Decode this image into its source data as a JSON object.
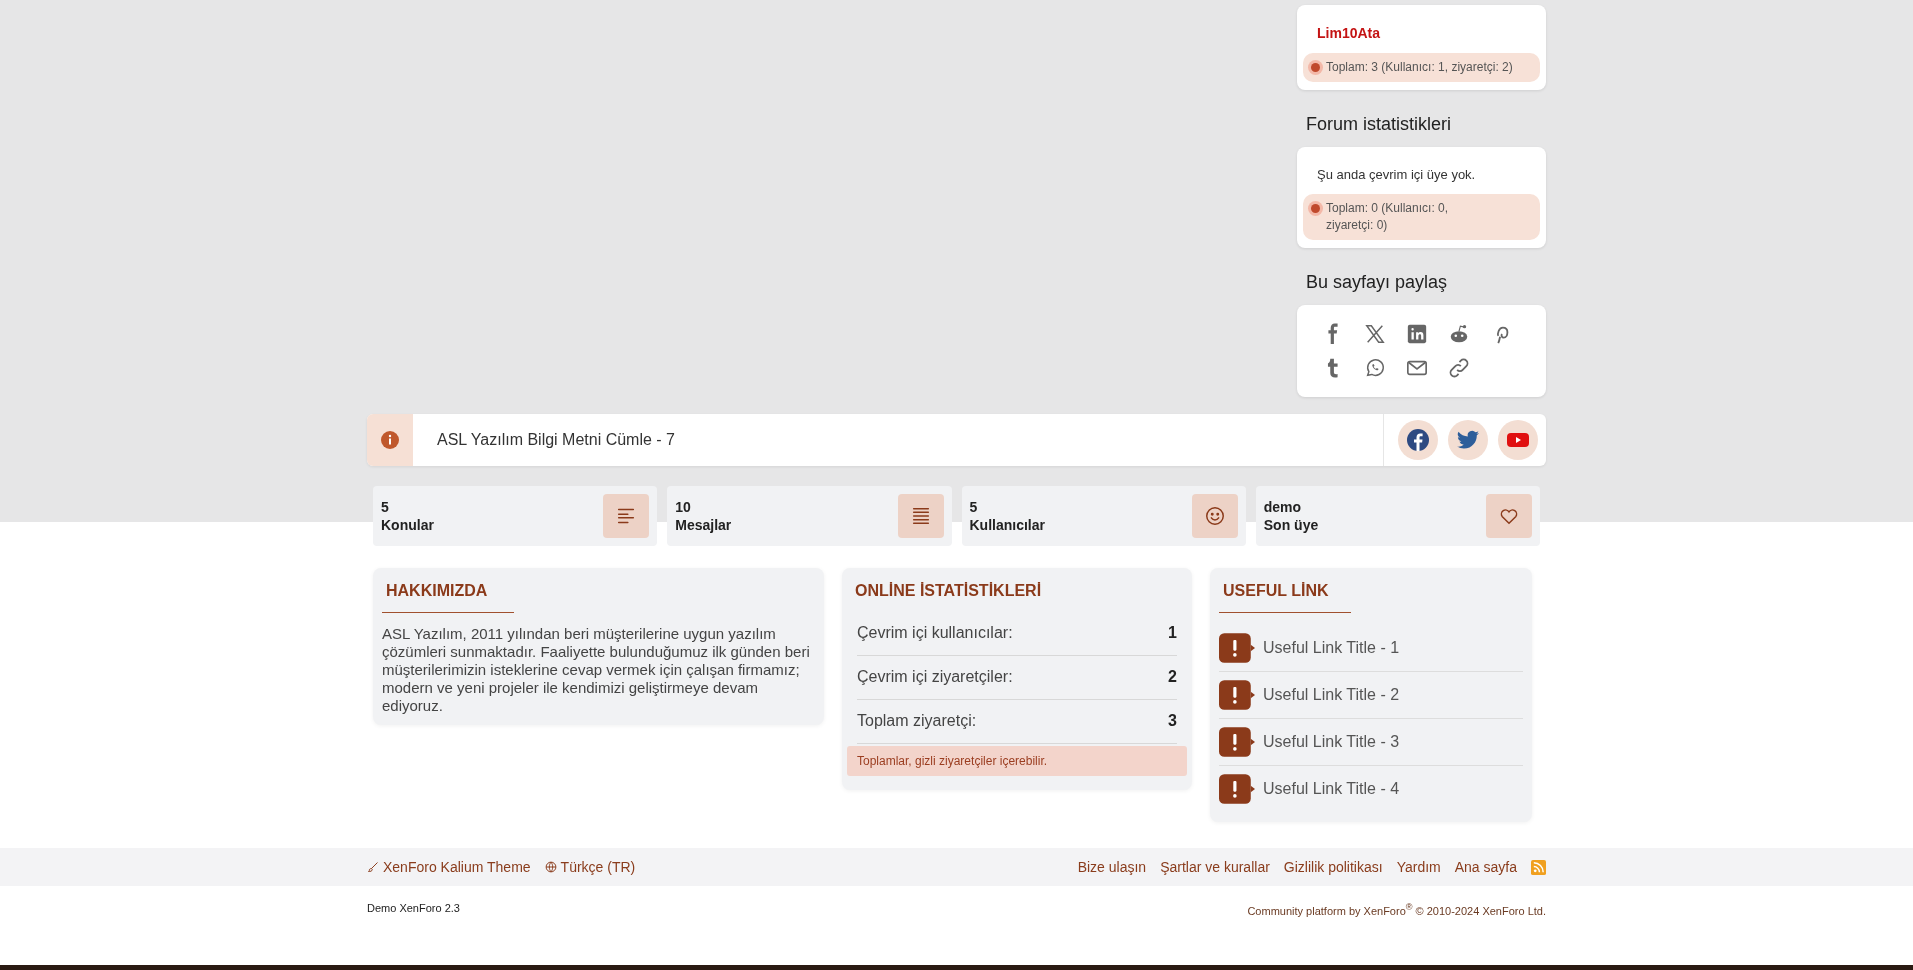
{
  "online_box": {
    "username": "Lim10Ata",
    "total": "Toplam: 3 (Kullanıcı: 1, ziyaretçi: 2)"
  },
  "forum_stats": {
    "title": "Forum istatistikleri",
    "message": "Şu anda çevrim içi üye yok.",
    "total": "Toplam: 0 (Kullanıcı: 0, ziyaretçi: 0)"
  },
  "share": {
    "title": "Bu sayfayı paylaş",
    "buttons": [
      {
        "kind": "facebook"
      },
      {
        "kind": "x"
      },
      {
        "kind": "linkedin"
      },
      {
        "kind": "reddit"
      },
      {
        "kind": "pinterest"
      },
      {
        "kind": "tumblr"
      },
      {
        "kind": "whatsapp"
      },
      {
        "kind": "email"
      },
      {
        "kind": "link"
      }
    ]
  },
  "notice": {
    "text": "ASL Yazılım Bilgi Metni Cümle - 7",
    "social": [
      {
        "kind": "facebook"
      },
      {
        "kind": "twitter"
      },
      {
        "kind": "youtube"
      }
    ]
  },
  "stats": [
    {
      "kind": "topics",
      "value": "5",
      "label": "Konular"
    },
    {
      "kind": "messages",
      "value": "10",
      "label": "Mesajlar"
    },
    {
      "kind": "users",
      "value": "5",
      "label": "Kullanıcılar"
    },
    {
      "kind": "member",
      "value": "demo",
      "label": "Son üye"
    }
  ],
  "about": {
    "title": "HAKKIMIZDA",
    "text": "ASL Yazılım, 2011 yılından beri müşterilerine uygun yazılım çözümleri sunmaktadır. Faaliyette bulunduğumuz ilk günden beri müşterilerimizin isteklerine cevap vermek için çalışan firmamız; modern ve yeni projeler ile kendimizi geliştirmeye devam ediyoruz."
  },
  "online_stats": {
    "title": "ONLİNE İSTATİSTİKLERİ",
    "rows": [
      {
        "label": "Çevrim içi kullanıcılar:",
        "value": "1"
      },
      {
        "label": "Çevrim içi ziyaretçiler:",
        "value": "2"
      },
      {
        "label": "Toplam ziyaretçi:",
        "value": "3"
      }
    ],
    "note": "Toplamlar, gizli ziyaretçiler içerebilir."
  },
  "useful_links": {
    "title": "USEFUL LİNK",
    "items": [
      "Useful Link Title - 1",
      "Useful Link Title - 2",
      "Useful Link Title - 3",
      "Useful Link Title - 4"
    ]
  },
  "footer": {
    "left": [
      {
        "kind": "theme",
        "label": "XenForo Kalium Theme"
      },
      {
        "kind": "language",
        "label": "Türkçe (TR)"
      }
    ],
    "links": [
      "Bize ulaşın",
      "Şartlar ve kurallar",
      "Gizlilik politikası",
      "Yardım",
      "Ana sayfa"
    ],
    "rss": true,
    "version": "Demo XenForo 2.3",
    "copyright": "Community platform by XenForo$^{®}$ © 2010-2024 XenForo Ltd."
  }
}
